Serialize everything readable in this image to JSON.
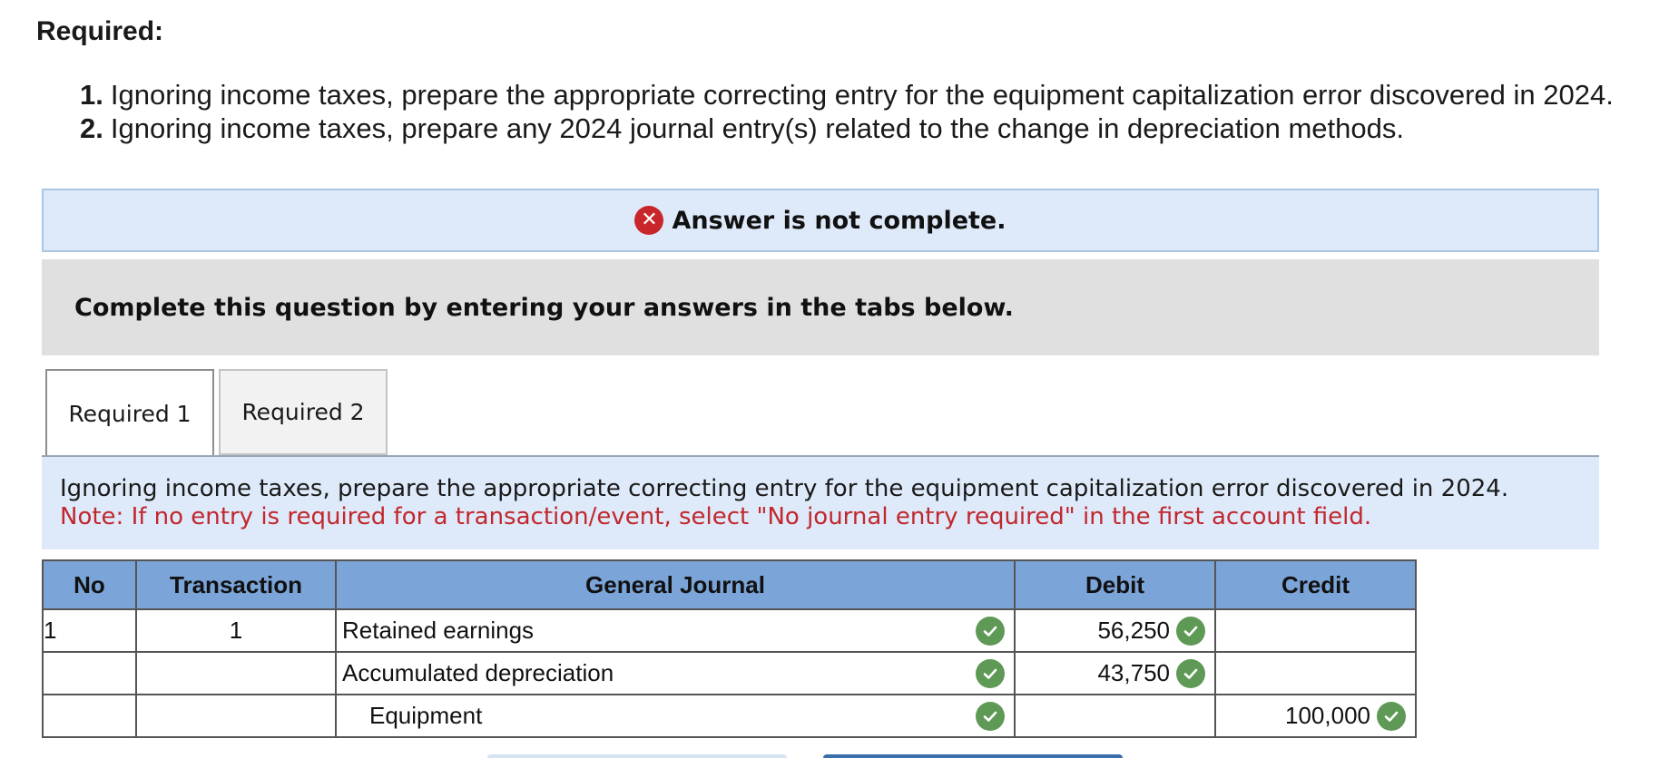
{
  "required": {
    "title": "Required:",
    "items": [
      {
        "num": "1.",
        "text": "Ignoring income taxes, prepare the appropriate correcting entry for the equipment capitalization error discovered in 2024."
      },
      {
        "num": "2.",
        "text": "Ignoring income taxes, prepare any 2024 journal entry(s) related to the change in depreciation methods."
      }
    ]
  },
  "status": {
    "message": "Answer is not complete.",
    "icon": "x-circle-icon",
    "icon_color": "#c8262b"
  },
  "instruction": "Complete this question by entering your answers in the tabs below.",
  "tabs": [
    {
      "label": "Required 1",
      "active": true
    },
    {
      "label": "Required 2",
      "active": false
    }
  ],
  "prompt": {
    "text": "Ignoring income taxes, prepare the appropriate correcting entry for the equipment capitalization error discovered in 2024.",
    "note": "Note: If no entry is required for a transaction/event, select \"No journal entry required\" in the first account field."
  },
  "journal": {
    "headers": {
      "no": "No",
      "transaction": "Transaction",
      "general_journal": "General Journal",
      "debit": "Debit",
      "credit": "Credit"
    },
    "header_color": "#7ba4d8",
    "check_color": "#5e9955",
    "rows": [
      {
        "no": "1",
        "transaction": "1",
        "account": "Retained earnings",
        "debit": "56,250",
        "credit": ""
      },
      {
        "no": "",
        "transaction": "",
        "account": "Accumulated depreciation",
        "debit": "43,750",
        "credit": ""
      },
      {
        "no": "",
        "transaction": "",
        "account": "Equipment",
        "debit": "",
        "credit": "100,000"
      }
    ]
  }
}
